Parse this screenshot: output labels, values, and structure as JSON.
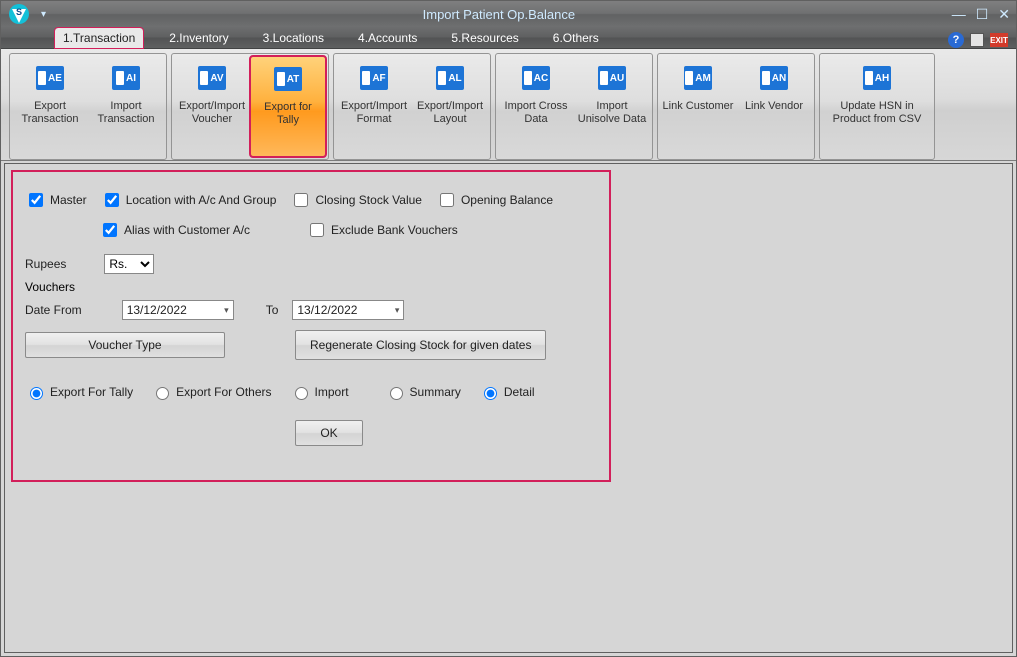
{
  "window": {
    "title": "Import Patient Op.Balance"
  },
  "menu": {
    "tabs": [
      "1.Transaction",
      "2.Inventory",
      "3.Locations",
      "4.Accounts",
      "5.Resources",
      "6.Others"
    ],
    "active": 0
  },
  "ribbon": {
    "groups": [
      {
        "buttons": [
          {
            "label": "Export Transaction",
            "icon": "AE"
          },
          {
            "label": "Import Transaction",
            "icon": "AI"
          }
        ]
      },
      {
        "buttons": [
          {
            "label": "Export/Import Voucher",
            "icon": "AV"
          },
          {
            "label": "Export for Tally",
            "icon": "AT",
            "selected": true
          }
        ]
      },
      {
        "buttons": [
          {
            "label": "Export/Import Format",
            "icon": "AF"
          },
          {
            "label": "Export/Import Layout",
            "icon": "AL"
          }
        ]
      },
      {
        "buttons": [
          {
            "label": "Import Cross Data",
            "icon": "AC"
          },
          {
            "label": "Import Unisolve Data",
            "icon": "AU"
          }
        ]
      },
      {
        "buttons": [
          {
            "label": "Link Customer",
            "icon": "AM"
          },
          {
            "label": "Link Vendor",
            "icon": "AN"
          }
        ]
      },
      {
        "buttons": [
          {
            "label": "Update HSN in Product from CSV",
            "icon": "AH",
            "wide": true
          }
        ]
      }
    ]
  },
  "form": {
    "master": {
      "label": "Master",
      "checked": true
    },
    "location": {
      "label": "Location with A/c And Group",
      "checked": true
    },
    "closing": {
      "label": "Closing Stock Value",
      "checked": false
    },
    "opening": {
      "label": "Opening Balance",
      "checked": false
    },
    "alias": {
      "label": "Alias with Customer A/c",
      "checked": true
    },
    "exclude": {
      "label": "Exclude Bank Vouchers",
      "checked": false
    },
    "rupees_label": "Rupees",
    "rupees_value": "Rs.",
    "vouchers_label": "Vouchers",
    "date_from_label": "Date From",
    "date_from": "13/12/2022",
    "date_to_label": "To",
    "date_to": "13/12/2022",
    "voucher_type_btn": "Voucher Type",
    "regen_btn": "Regenerate Closing Stock for given dates",
    "radios": {
      "export_tally": "Export For Tally",
      "export_others": "Export For Others",
      "import": "Import",
      "summary": "Summary",
      "detail": "Detail"
    },
    "ok": "OK"
  }
}
